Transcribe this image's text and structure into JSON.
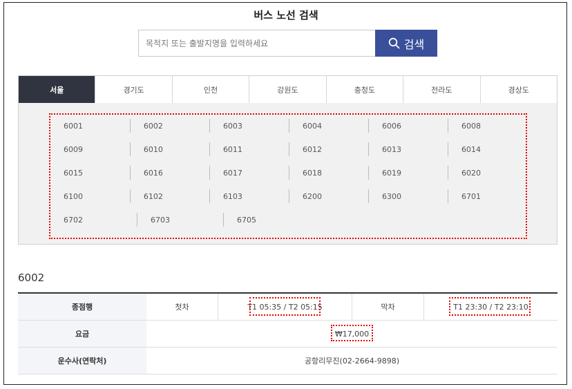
{
  "page": {
    "title": "버스 노선 검색"
  },
  "search": {
    "placeholder": "목적지 또는 출발지명을 입력하세요",
    "button_label": "검색",
    "icon": "search-icon"
  },
  "tabs": [
    "서울",
    "경기도",
    "인천",
    "강원도",
    "충청도",
    "전라도",
    "경상도"
  ],
  "active_tab": "서울",
  "routes": [
    [
      "6001",
      "6002",
      "6003",
      "6004",
      "6006",
      "6008"
    ],
    [
      "6009",
      "6010",
      "6011",
      "6012",
      "6013",
      "6014"
    ],
    [
      "6015",
      "6016",
      "6017",
      "6018",
      "6019",
      "6020"
    ],
    [
      "6100",
      "6102",
      "6103",
      "6200",
      "6300",
      "6701"
    ],
    [
      "6702",
      "6703",
      "6705"
    ]
  ],
  "selected_route": "6002",
  "info": {
    "row1": {
      "label": "종점행",
      "first_label": "첫차",
      "first_value": "T1 05:35 / T2 05:15",
      "last_label": "막차",
      "last_value": "T1 23:30 / T2 23:10"
    },
    "row2": {
      "label": "요금",
      "value": "₩17,000"
    },
    "row3": {
      "label": "운수사(연락처)",
      "value": "공항리무진(02-2664-9898)"
    }
  },
  "colors": {
    "accent": "#3a4f9a",
    "active_tab": "#2f3440",
    "highlight": "#e00000"
  }
}
